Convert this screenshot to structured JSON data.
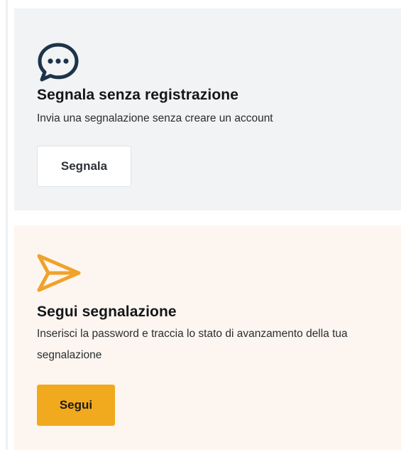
{
  "report_card": {
    "icon": "chat-bubble-icon",
    "title": "Segnala senza registrazione",
    "description": "Invia una segnalazione senza creare un account",
    "button_label": "Segnala"
  },
  "follow_card": {
    "icon": "send-icon",
    "title": "Segui segnalazione",
    "description": "Inserisci la password e traccia lo stato di avanzamento della tua segnalazione",
    "button_label": "Segui"
  },
  "colors": {
    "report_card_bg": "#f1f3f4",
    "follow_card_bg": "#fdf6f0",
    "chat_icon": "#1d3349",
    "send_icon": "#f0a22a",
    "follow_button_bg": "#f1aa1d"
  }
}
